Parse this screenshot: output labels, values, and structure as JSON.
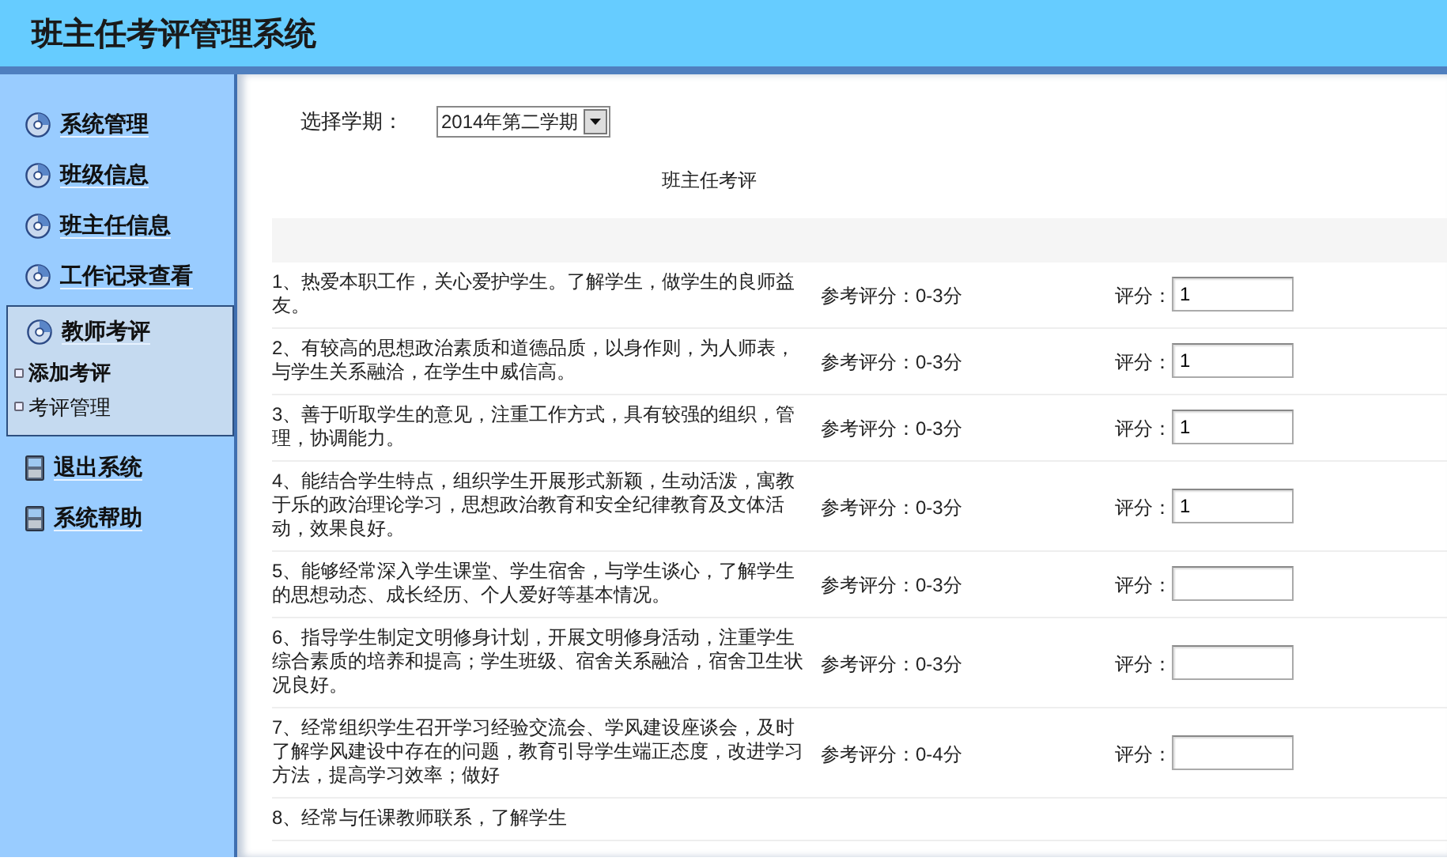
{
  "header": {
    "title": "班主任考评管理系统"
  },
  "sidebar": {
    "items": [
      {
        "label": "系统管理",
        "kind": "disc"
      },
      {
        "label": "班级信息",
        "kind": "disc"
      },
      {
        "label": "班主任信息",
        "kind": "disc"
      },
      {
        "label": "工作记录查看",
        "kind": "disc"
      },
      {
        "label": "教师考评",
        "kind": "disc",
        "expanded": true,
        "children": [
          {
            "label": "添加考评",
            "selected": true
          },
          {
            "label": "考评管理",
            "selected": false
          }
        ]
      },
      {
        "label": "退出系统",
        "kind": "device"
      },
      {
        "label": "系统帮助",
        "kind": "device"
      }
    ]
  },
  "filter": {
    "label": "选择学期：",
    "value": "2014年第二学期"
  },
  "form": {
    "title": "班主任考评",
    "rows": [
      {
        "text": "1、热爱本职工作，关心爱护学生。了解学生，做学生的良师益友。",
        "reference": "参考评分：0-3分",
        "score_label": "评分：",
        "value": "1"
      },
      {
        "text": "2、有较高的思想政治素质和道德品质，以身作则，为人师表，与学生关系融洽，在学生中威信高。",
        "reference": "参考评分：0-3分",
        "score_label": "评分：",
        "value": "1"
      },
      {
        "text": "3、善于听取学生的意见，注重工作方式，具有较强的组织，管理，协调能力。",
        "reference": "参考评分：0-3分",
        "score_label": "评分：",
        "value": "1"
      },
      {
        "text": "4、能结合学生特点，组织学生开展形式新颖，生动活泼，寓教于乐的政治理论学习，思想政治教育和安全纪律教育及文体活动，效果良好。",
        "reference": "参考评分：0-3分",
        "score_label": "评分：",
        "value": "1"
      },
      {
        "text": "5、能够经常深入学生课堂、学生宿舍，与学生谈心，了解学生的思想动态、成长经历、个人爱好等基本情况。",
        "reference": "参考评分：0-3分",
        "score_label": "评分："
      },
      {
        "text": "6、指导学生制定文明修身计划，开展文明修身活动，注重学生综合素质的培养和提高；学生班级、宿舍关系融洽，宿舍卫生状况良好。",
        "reference": "参考评分：0-3分",
        "score_label": "评分："
      },
      {
        "text": "7、经常组织学生召开学习经验交流会、学风建设座谈会，及时了解学风建设中存在的问题，教育引导学生端正态度，改进学习方法，提高学习效率；做好",
        "reference": "参考评分：0-4分",
        "score_label": "评分："
      },
      {
        "text": "8、经常与任课教师联系，了解学生"
      }
    ]
  }
}
